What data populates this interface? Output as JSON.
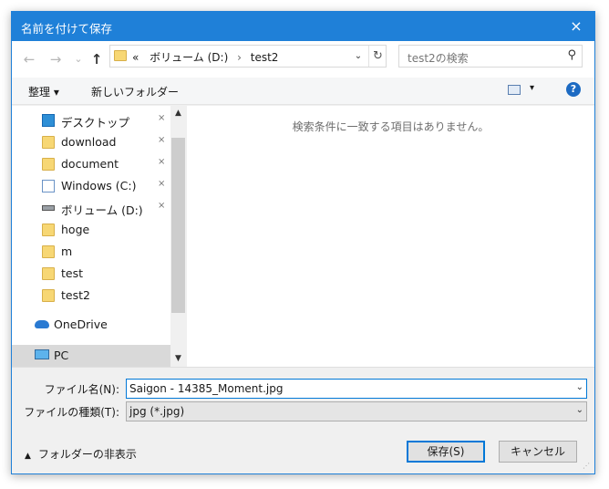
{
  "titlebar": {
    "title": "名前を付けて保存",
    "close_icon": "×"
  },
  "nav": {
    "back_icon": "←",
    "forward_icon": "→",
    "recent_icon": "⌄",
    "up_icon": "↑",
    "crumb_prefix": "«",
    "crumbs": [
      "ボリューム (D:)",
      "test2"
    ],
    "crumb_sep": "›",
    "dropdown_icon": "⌄",
    "refresh_icon": "↻",
    "search_placeholder": "test2の検索",
    "search_icon": "⚲"
  },
  "toolbar": {
    "organize": "整理 ▾",
    "new_folder": "新しいフォルダー",
    "view_dropdown": "▾",
    "help": "?"
  },
  "navpane": {
    "items": [
      {
        "label": "デスクトップ",
        "icon": "desktop-icon",
        "pinned": true
      },
      {
        "label": "download",
        "icon": "folder-icon",
        "pinned": true
      },
      {
        "label": "document",
        "icon": "folder-icon",
        "pinned": true
      },
      {
        "label": "Windows (C:)",
        "icon": "drive-c-icon",
        "pinned": true
      },
      {
        "label": "ボリューム (D:)",
        "icon": "drive-d-icon",
        "pinned": true
      },
      {
        "label": "hoge",
        "icon": "folder-icon",
        "pinned": false
      },
      {
        "label": "m",
        "icon": "folder-icon",
        "pinned": false
      },
      {
        "label": "test",
        "icon": "folder-icon",
        "pinned": false
      },
      {
        "label": "test2",
        "icon": "folder-icon",
        "pinned": false
      },
      {
        "label": "OneDrive",
        "icon": "onedrive-icon",
        "pinned": false
      },
      {
        "label": "PC",
        "icon": "pc-icon",
        "pinned": false,
        "selected": true
      }
    ],
    "pin_glyph": "📌",
    "scroll_up": "▲",
    "scroll_down": "▼"
  },
  "content": {
    "empty_message": "検索条件に一致する項目はありません。"
  },
  "bottom": {
    "filename_label": "ファイル名(N):",
    "filename_value": "Saigon - 14385_Moment.jpg",
    "filetype_label": "ファイルの種類(T):",
    "filetype_value": "jpg (*.jpg)",
    "dropdown_icon": "⌄",
    "hide_folders": "フォルダーの非表示",
    "hide_folders_chevron": "▲",
    "save_button": "保存(S)",
    "cancel_button": "キャンセル"
  },
  "colors": {
    "accent": "#1f80d8",
    "folder": "#f7d774",
    "selected": "#d9d9d9"
  }
}
